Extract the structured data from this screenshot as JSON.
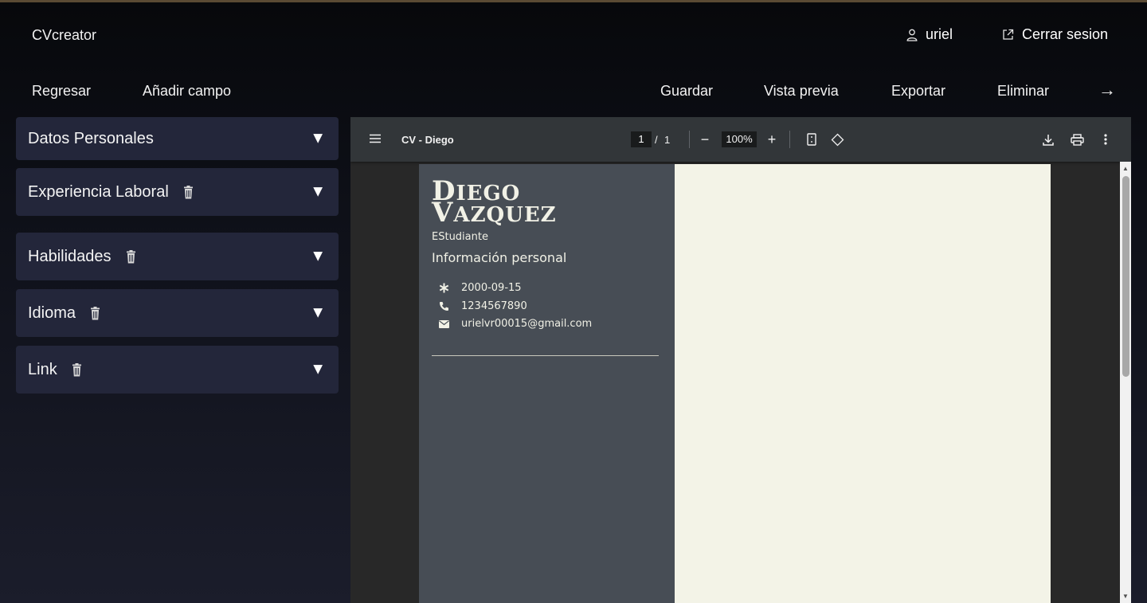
{
  "header": {
    "brand": "CVcreator",
    "user": {
      "name": "uriel",
      "icon": "user-icon"
    },
    "logout": {
      "label": "Cerrar sesion",
      "icon": "external-link-icon"
    }
  },
  "toolbar": {
    "back": "Regresar",
    "add_field": "Añadir campo",
    "save": "Guardar",
    "preview": "Vista previa",
    "export": "Exportar",
    "delete": "Eliminar",
    "next_arrow": "→"
  },
  "sections": [
    {
      "label": "Datos Personales",
      "deletable": false,
      "chevron": "▼"
    },
    {
      "label": "Experiencia Laboral",
      "deletable": true,
      "chevron": "▼"
    },
    {
      "label": "Habilidades",
      "deletable": true,
      "chevron": "▼"
    },
    {
      "label": "Idioma",
      "deletable": true,
      "chevron": "▼"
    },
    {
      "label": "Link",
      "deletable": true,
      "chevron": "▼"
    }
  ],
  "viewer": {
    "title": "CV - Diego",
    "page_current": "1",
    "page_sep": "/",
    "page_total": "1",
    "zoom": "100%",
    "zoom_out": "−",
    "zoom_in": "+"
  },
  "cv": {
    "first_name_initial": "D",
    "first_name_rest": "IEGO",
    "last_name_initial": "V",
    "last_name_rest": "AZQUEZ",
    "role": "EStudiante",
    "section_title": "Información personal",
    "birthdate": "2000-09-15",
    "phone": "1234567890",
    "email": "urielvr00015@gmail.com"
  },
  "colors": {
    "cv_sidebar": "#474d55",
    "cv_page": "#f3f3e7",
    "panel": "#23263a",
    "viewer_bar": "#323639"
  }
}
